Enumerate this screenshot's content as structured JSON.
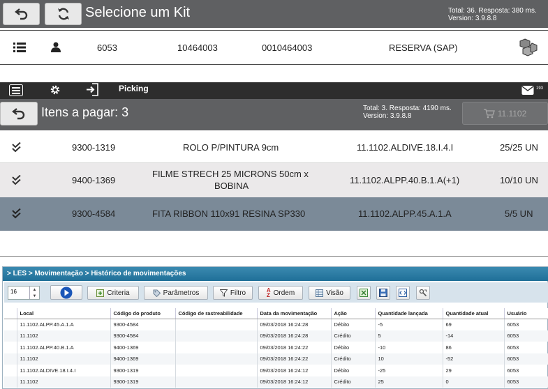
{
  "kit_panel": {
    "title": "Selecione um Kit",
    "stats_line1": "Total: 36. Resposta: 380 ms.",
    "stats_line2": "Version: 3.9.8.8",
    "row": {
      "id": "6053",
      "code": "10464003",
      "code_full": "0010464003",
      "status": "RESERVA (SAP)"
    }
  },
  "picking_panel": {
    "topbar_label": "Picking",
    "notif_count": "193",
    "title": "Itens a pagar: 3",
    "stats_line1": "Total: 3. Resposta: 4190 ms.",
    "stats_line2": "Version: 3.9.8.8",
    "cart_label": "11.1102",
    "items": [
      {
        "code": "9300-1319",
        "desc": "ROLO P/PINTURA 9cm",
        "desc2": "",
        "loc": "11.1102.ALDIVE.18.I.4.I",
        "qty": "25/25 UN"
      },
      {
        "code": "9400-1369",
        "desc": "FILME STRECH 25 MICRONS 50cm x",
        "desc2": "BOBINA",
        "loc": "11.1102.ALPP.40.B.1.A(+1)",
        "qty": "10/10 UN"
      },
      {
        "code": "9300-4584",
        "desc": "FITA RIBBON 110x91 RESINA SP330",
        "desc2": "",
        "loc": "11.1102.ALPP.45.A.1.A",
        "qty": "5/5 UN"
      }
    ]
  },
  "les_panel": {
    "breadcrumb": "> LES > Movimentação > Histórico de movimentações",
    "page_size": "16",
    "toolbar": {
      "criteria": "Criteria",
      "parametros": "Parâmetros",
      "filtro": "Filtro",
      "ordem": "Ordem",
      "visao": "Visão"
    },
    "columns": [
      "Local",
      "Código do produto",
      "Código de rastreabilidade",
      "Data da movimentação",
      "Ação",
      "Quantidade lançada",
      "Quantidade atual",
      "Usuário"
    ],
    "rows": [
      [
        "11.1102.ALPP.45.A.1.A",
        "9300-4584",
        "",
        "09/03/2018 16:24:28",
        "Débito",
        "-5",
        "69",
        "6053"
      ],
      [
        "11.1102",
        "9300-4584",
        "",
        "09/03/2018 16:24:28",
        "Crédito",
        "5",
        "-14",
        "6053"
      ],
      [
        "11.1102.ALPP.40.B.1.A",
        "9400-1369",
        "",
        "09/03/2018 16:24:22",
        "Débito",
        "-10",
        "86",
        "6053"
      ],
      [
        "11.1102",
        "9400-1369",
        "",
        "09/03/2018 16:24:22",
        "Crédito",
        "10",
        "-52",
        "6053"
      ],
      [
        "11.1102.ALDIVE.18.I.4.I",
        "9300-1319",
        "",
        "09/03/2018 16:24:12",
        "Débito",
        "-25",
        "29",
        "6053"
      ],
      [
        "11.1102",
        "9300-1319",
        "",
        "09/03/2018 16:24:12",
        "Crédito",
        "25",
        "0",
        "6053"
      ]
    ]
  }
}
